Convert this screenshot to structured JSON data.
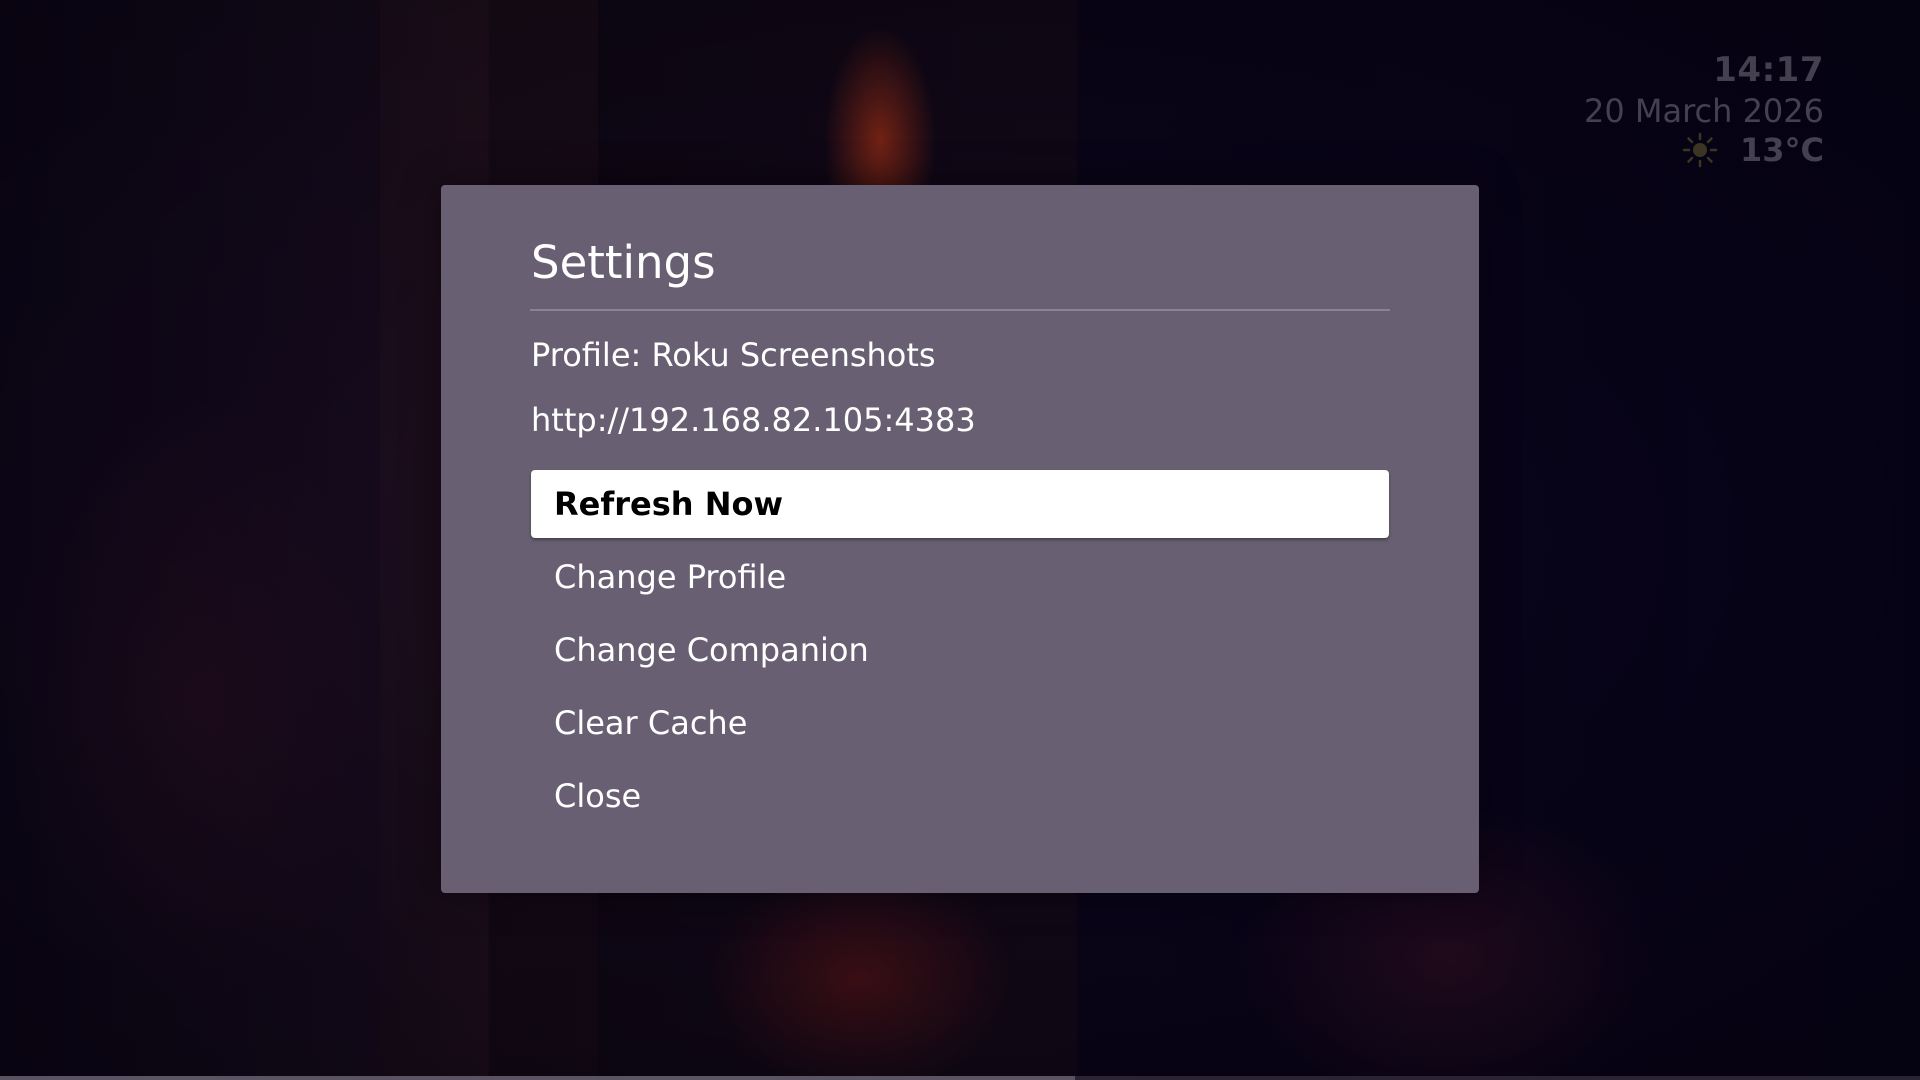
{
  "status": {
    "time": "14:17",
    "date": "20 March 2026",
    "temperature": "13°C",
    "weather_icon": "sun-icon"
  },
  "dialog": {
    "title": "Settings",
    "profile_text": "Profile: Roku Screenshots",
    "url_text": "http://192.168.82.105:4383",
    "menu": [
      {
        "label": "Refresh Now",
        "selected": true
      },
      {
        "label": "Change Profile",
        "selected": false
      },
      {
        "label": "Change Companion",
        "selected": false
      },
      {
        "label": "Clear Cache",
        "selected": false
      },
      {
        "label": "Close",
        "selected": false
      }
    ]
  },
  "playback": {
    "progress_fraction": 0.56
  },
  "colors": {
    "dialog_bg": "#686072",
    "selected_bg": "#ffffff",
    "status_text": "#45404f"
  }
}
